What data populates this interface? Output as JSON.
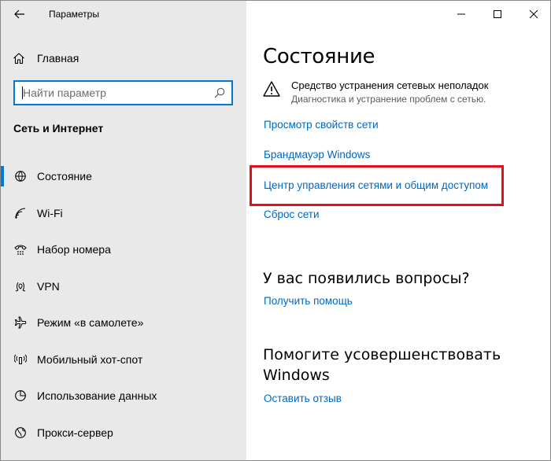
{
  "window": {
    "title": "Параметры"
  },
  "sidebar": {
    "home_label": "Главная",
    "search_placeholder": "Найти параметр",
    "section_title": "Сеть и Интернет",
    "items": [
      {
        "label": "Состояние",
        "icon": "status-icon"
      },
      {
        "label": "Wi-Fi",
        "icon": "wifi-icon"
      },
      {
        "label": "Набор номера",
        "icon": "dialup-icon"
      },
      {
        "label": "VPN",
        "icon": "vpn-icon"
      },
      {
        "label": "Режим «в самолете»",
        "icon": "airplane-icon"
      },
      {
        "label": "Мобильный хот-спот",
        "icon": "hotspot-icon"
      },
      {
        "label": "Использование данных",
        "icon": "data-usage-icon"
      },
      {
        "label": "Прокси-сервер",
        "icon": "globe-icon"
      }
    ],
    "active_index": 0
  },
  "main": {
    "title": "Состояние",
    "troubleshooter": {
      "title": "Средство устранения сетевых неполадок",
      "subtitle": "Диагностика и устранение проблем с сетью."
    },
    "links": [
      "Просмотр свойств сети",
      "Брандмауэр Windows",
      "Центр управления сетями и общим доступом",
      "Сброс сети"
    ],
    "questions": {
      "heading": "У вас появились вопросы?",
      "link": "Получить помощь"
    },
    "improve": {
      "heading_line1": "Помогите усовершенствовать",
      "heading_line2": "Windows",
      "link": "Оставить отзыв"
    }
  },
  "colors": {
    "accent": "#0078d7",
    "link": "#0067c0",
    "highlight": "#e30e1a",
    "sidebar_bg": "#e9e9e9"
  }
}
